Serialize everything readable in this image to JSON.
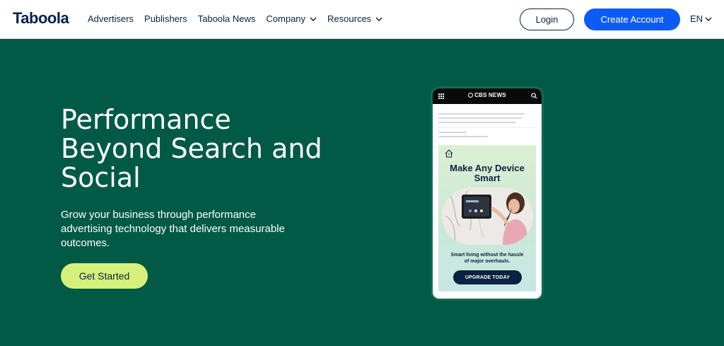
{
  "nav": {
    "logo": "Taboola",
    "items": [
      {
        "label": "Advertisers",
        "dropdown": false
      },
      {
        "label": "Publishers",
        "dropdown": false
      },
      {
        "label": "Taboola News",
        "dropdown": false
      },
      {
        "label": "Company",
        "dropdown": true
      },
      {
        "label": "Resources",
        "dropdown": true
      }
    ],
    "login_label": "Login",
    "create_account_label": "Create Account",
    "language": "EN"
  },
  "hero": {
    "headline": "Performance Beyond Search and Social",
    "subtext": "Grow your business through performance advertising technology that delivers measurable outcomes.",
    "cta_label": "Get Started"
  },
  "phone": {
    "site_name": "CBS NEWS",
    "ad": {
      "title": "Make Any Device Smart",
      "description": "Smart living without the hassle of major overhauls.",
      "cta_label": "UPGRADE TODAY"
    }
  },
  "colors": {
    "hero_bg": "#005a45",
    "accent_lime": "#d6f17a",
    "primary_blue": "#0c5cf3",
    "navy": "#0b2142"
  }
}
